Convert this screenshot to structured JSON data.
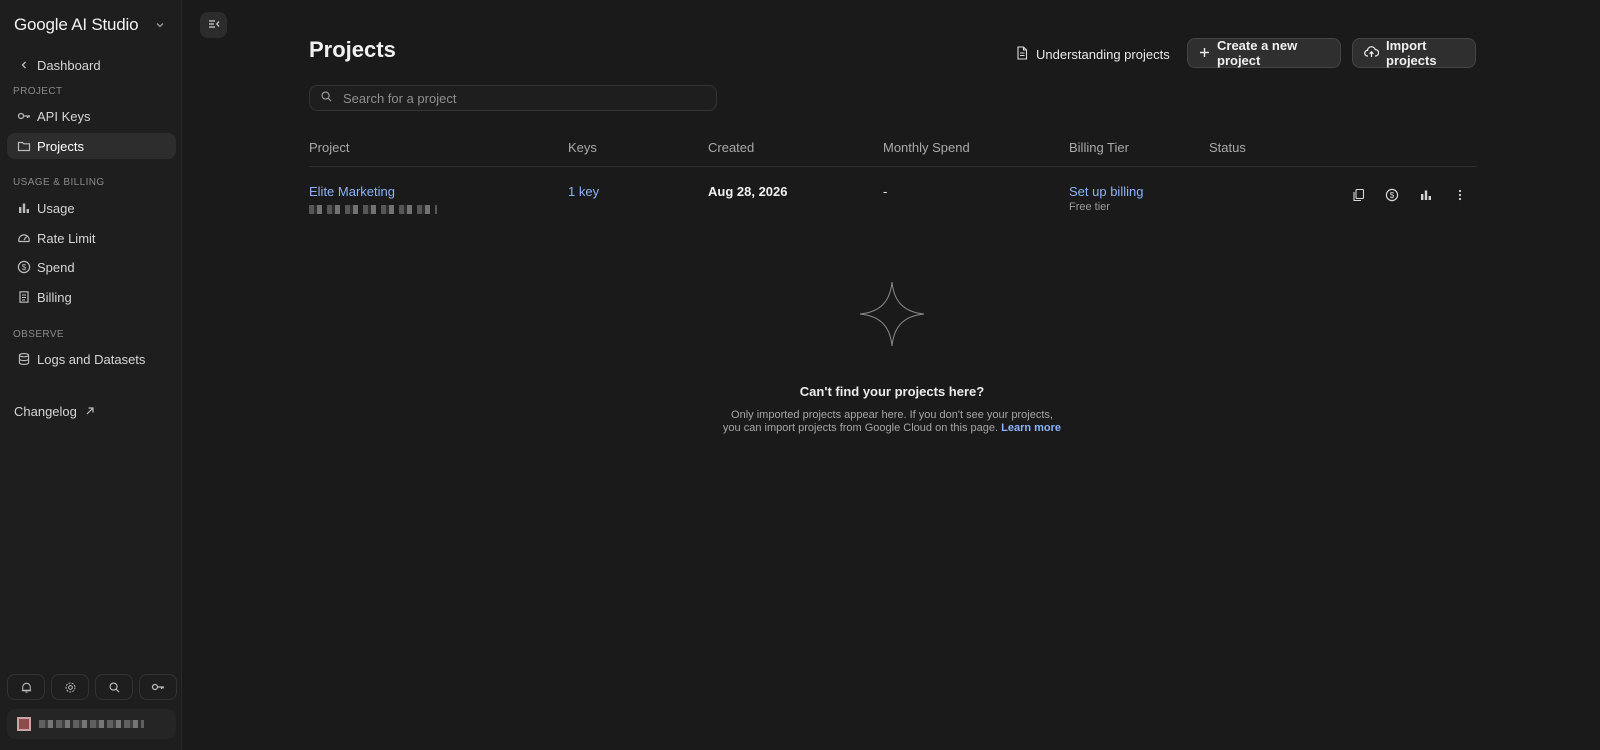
{
  "brand": {
    "title": "Google AI Studio"
  },
  "sidebar": {
    "back": "Dashboard",
    "sections": {
      "project": "PROJECT",
      "usage": "USAGE & BILLING",
      "observe": "OBSERVE"
    },
    "items": {
      "api_keys": "API Keys",
      "projects": "Projects",
      "usage": "Usage",
      "rate_limit": "Rate Limit",
      "spend": "Spend",
      "billing": "Billing",
      "logs": "Logs and Datasets"
    },
    "changelog": "Changelog"
  },
  "header": {
    "title": "Projects",
    "understanding": "Understanding projects",
    "create": "Create a new project",
    "import": "Import projects"
  },
  "search": {
    "placeholder": "Search for a project"
  },
  "table": {
    "columns": [
      "Project",
      "Keys",
      "Created",
      "Monthly Spend",
      "Billing Tier",
      "Status"
    ],
    "rows": [
      {
        "project": "Elite Marketing",
        "keys": "1 key",
        "created": "Aug 28, 2026",
        "spend": "-",
        "billing": "Set up billing",
        "tier": "Free tier"
      }
    ]
  },
  "empty": {
    "title": "Can't find your projects here?",
    "line1": "Only imported projects appear here. If you don't see your projects,",
    "line2": "you can import projects from Google Cloud on this page.",
    "learn_more": "Learn more"
  },
  "colors": {
    "background": "#1a1a1a",
    "sidebar": "#1e1e1e",
    "link": "#8ab4f8"
  }
}
